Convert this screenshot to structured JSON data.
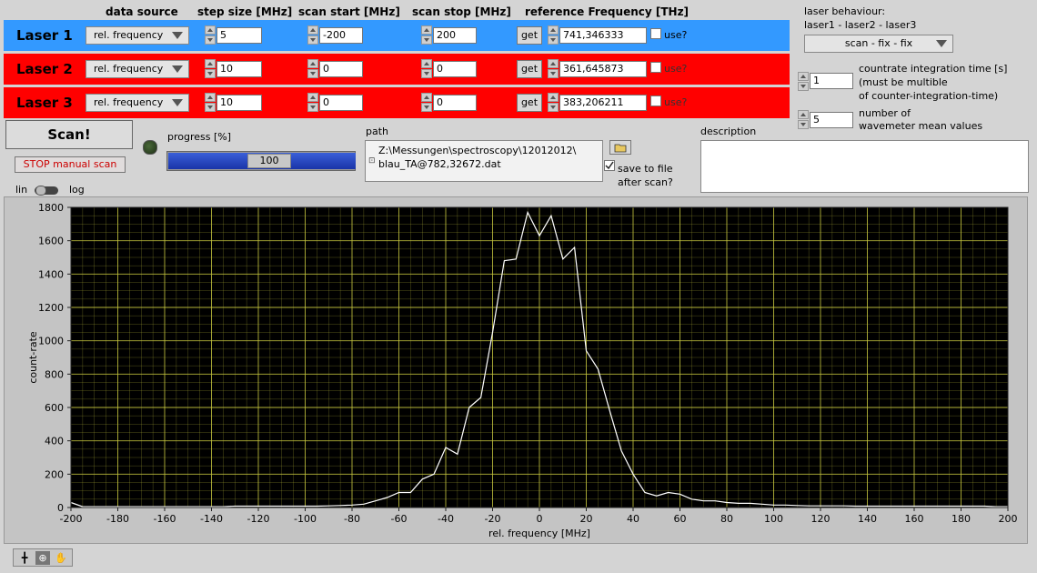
{
  "headers": {
    "data_source": "data source",
    "step_size": "step size [MHz]",
    "scan_start": "scan start [MHz]",
    "scan_stop": "scan stop [MHz]",
    "ref_freq": "reference Frequency [THz]"
  },
  "lasers": [
    {
      "name": "Laser 1",
      "source": "rel. frequency",
      "step": "5",
      "start": "-200",
      "stop": "200",
      "get": "get",
      "ref": "741,346333",
      "use": "use?",
      "color": "#3399ff"
    },
    {
      "name": "Laser 2",
      "source": "rel. frequency",
      "step": "10",
      "start": "0",
      "stop": "0",
      "get": "get",
      "ref": "361,645873",
      "use": "use?",
      "color": "#ff0000"
    },
    {
      "name": "Laser 3",
      "source": "rel. frequency",
      "step": "10",
      "start": "0",
      "stop": "0",
      "get": "get",
      "ref": "383,206211",
      "use": "use?",
      "color": "#ff0000"
    }
  ],
  "behaviour": {
    "label1": "laser behaviour:",
    "label2": "laser1 - laser2 - laser3",
    "value": "scan - fix - fix"
  },
  "countrate": {
    "value": "1",
    "label1": "countrate integration time [s]",
    "label2": "(must be multible",
    "label3": "of counter-integration-time)"
  },
  "wavemeter": {
    "value": "5",
    "label1": "number of",
    "label2": "wavemeter mean values"
  },
  "scan_button": "Scan!",
  "stop_button": "STOP manual scan",
  "progress": {
    "label": "progress [%]",
    "value": "100",
    "fraction": 1.0
  },
  "path": {
    "label": "path",
    "line1": "Z:\\Messungen\\spectroscopy\\12012012\\",
    "line2": "blau_TA@782,32672.dat"
  },
  "save": {
    "label1": "save to file",
    "label2": "after scan?"
  },
  "description": {
    "label": "description",
    "value": ""
  },
  "scale": {
    "lin": "lin",
    "log": "log"
  },
  "colors": {
    "plot_bg": "#000000",
    "grid": "#c8c840",
    "trace": "#ffffff",
    "laser1": "#3399ff",
    "laser23": "#ff0000"
  },
  "chart_data": {
    "type": "line",
    "xlabel": "rel. frequency [MHz]",
    "ylabel": "count-rate",
    "xlim": [
      -200,
      200
    ],
    "ylim": [
      0,
      1800
    ],
    "xticks": [
      "-200",
      "-180",
      "-160",
      "-140",
      "-120",
      "-100",
      "-80",
      "-60",
      "-40",
      "-20",
      "0",
      "20",
      "40",
      "60",
      "80",
      "100",
      "120",
      "140",
      "160",
      "180",
      "200"
    ],
    "yticks": [
      "0",
      "200",
      "400",
      "600",
      "800",
      "1000",
      "1200",
      "1400",
      "1600",
      "1800"
    ],
    "grid": true,
    "x": [
      -200,
      -195,
      -190,
      -185,
      -180,
      -175,
      -170,
      -165,
      -160,
      -155,
      -150,
      -145,
      -140,
      -135,
      -130,
      -125,
      -120,
      -115,
      -110,
      -105,
      -100,
      -95,
      -90,
      -85,
      -80,
      -75,
      -70,
      -65,
      -60,
      -55,
      -50,
      -45,
      -40,
      -35,
      -30,
      -25,
      -20,
      -15,
      -10,
      -5,
      0,
      5,
      10,
      15,
      20,
      25,
      30,
      35,
      40,
      45,
      50,
      55,
      60,
      65,
      70,
      75,
      80,
      85,
      90,
      95,
      100,
      105,
      110,
      115,
      120,
      125,
      130,
      135,
      140,
      145,
      150,
      155,
      160,
      165,
      170,
      175,
      180,
      185,
      190,
      195,
      200
    ],
    "y": [
      30,
      5,
      5,
      5,
      5,
      5,
      5,
      5,
      5,
      5,
      5,
      5,
      5,
      5,
      8,
      8,
      8,
      8,
      8,
      8,
      8,
      8,
      10,
      12,
      15,
      20,
      40,
      60,
      90,
      90,
      170,
      200,
      360,
      320,
      600,
      660,
      1050,
      1480,
      1490,
      1770,
      1630,
      1750,
      1490,
      1560,
      940,
      830,
      580,
      340,
      200,
      90,
      70,
      90,
      80,
      50,
      40,
      40,
      30,
      25,
      25,
      20,
      15,
      15,
      12,
      10,
      10,
      10,
      10,
      8,
      8,
      8,
      8,
      8,
      8,
      8,
      8,
      8,
      8,
      8,
      8,
      5,
      5
    ]
  }
}
